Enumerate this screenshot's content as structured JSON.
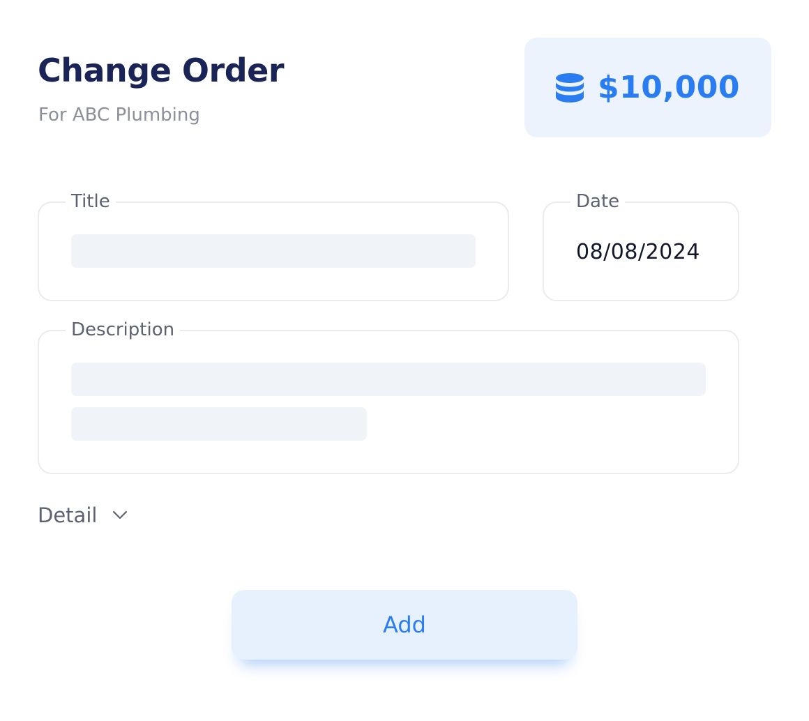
{
  "header": {
    "title": "Change Order",
    "subtitle": "For ABC Plumbing"
  },
  "amount": {
    "icon": "coins-stack-icon",
    "value": "$10,000",
    "accent_color": "#2a7df0",
    "background_color": "#ecf3fd"
  },
  "form": {
    "title": {
      "label": "Title",
      "value": ""
    },
    "date": {
      "label": "Date",
      "value": "08/08/2024"
    },
    "description": {
      "label": "Description",
      "value": ""
    }
  },
  "detail": {
    "label": "Detail",
    "icon": "chevron-down-icon"
  },
  "actions": {
    "add_label": "Add"
  }
}
